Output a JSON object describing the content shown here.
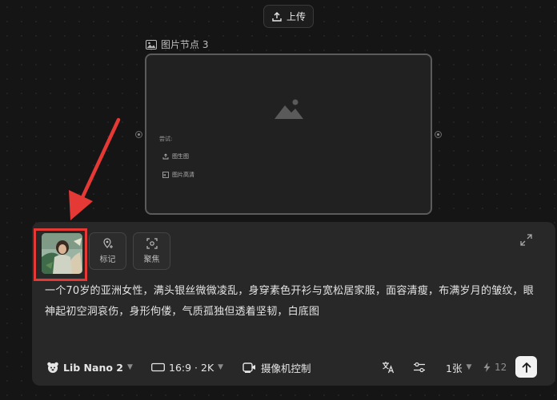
{
  "toolbar": {
    "upload_label": "上传"
  },
  "node": {
    "title": "图片节点 3",
    "try_label": "尝试:",
    "actions": [
      {
        "label": "图生图",
        "icon": "upload-icon"
      },
      {
        "label": "图片高清",
        "icon": "hd-icon"
      }
    ]
  },
  "panel": {
    "tools": [
      {
        "label": "标记",
        "icon": "location-pin-icon"
      },
      {
        "label": "聚焦",
        "icon": "focus-icon"
      }
    ],
    "prompt": "一个70岁的亚洲女性，满头银丝微微凌乱，身穿素色开衫与宽松居家服，面容清瘦，布满岁月的皱纹，眼神起初空洞哀伤，身形佝偻，气质孤独但透着坚韧，白底图",
    "model": "Lib Nano 2",
    "ratio": "16:9 · 2K",
    "camera": "摄像机控制",
    "count": "1张",
    "credits": "12"
  },
  "colors": {
    "annotation_red": "#e53935",
    "panel_bg": "#282828",
    "canvas_bg": "#151515"
  }
}
